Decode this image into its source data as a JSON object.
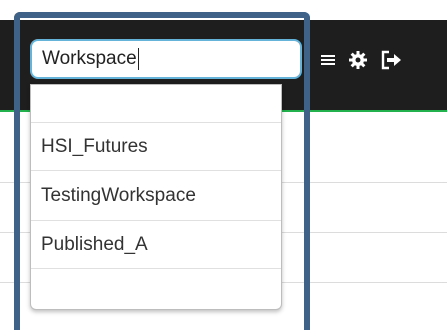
{
  "search": {
    "value": "Workspace"
  },
  "dropdown": {
    "options": [
      {
        "label": ""
      },
      {
        "label": "HSI_Futures"
      },
      {
        "label": "TestingWorkspace"
      },
      {
        "label": "Published_A"
      },
      {
        "label": ""
      }
    ]
  },
  "toolbar": {
    "icons": [
      "menu-icon",
      "gear-icon",
      "sign-out-icon"
    ]
  },
  "colors": {
    "topbar": "#1e1e1e",
    "accent_line": "#22b14c",
    "highlight_frame": "#3f6288",
    "input_border": "#66b3d9"
  }
}
